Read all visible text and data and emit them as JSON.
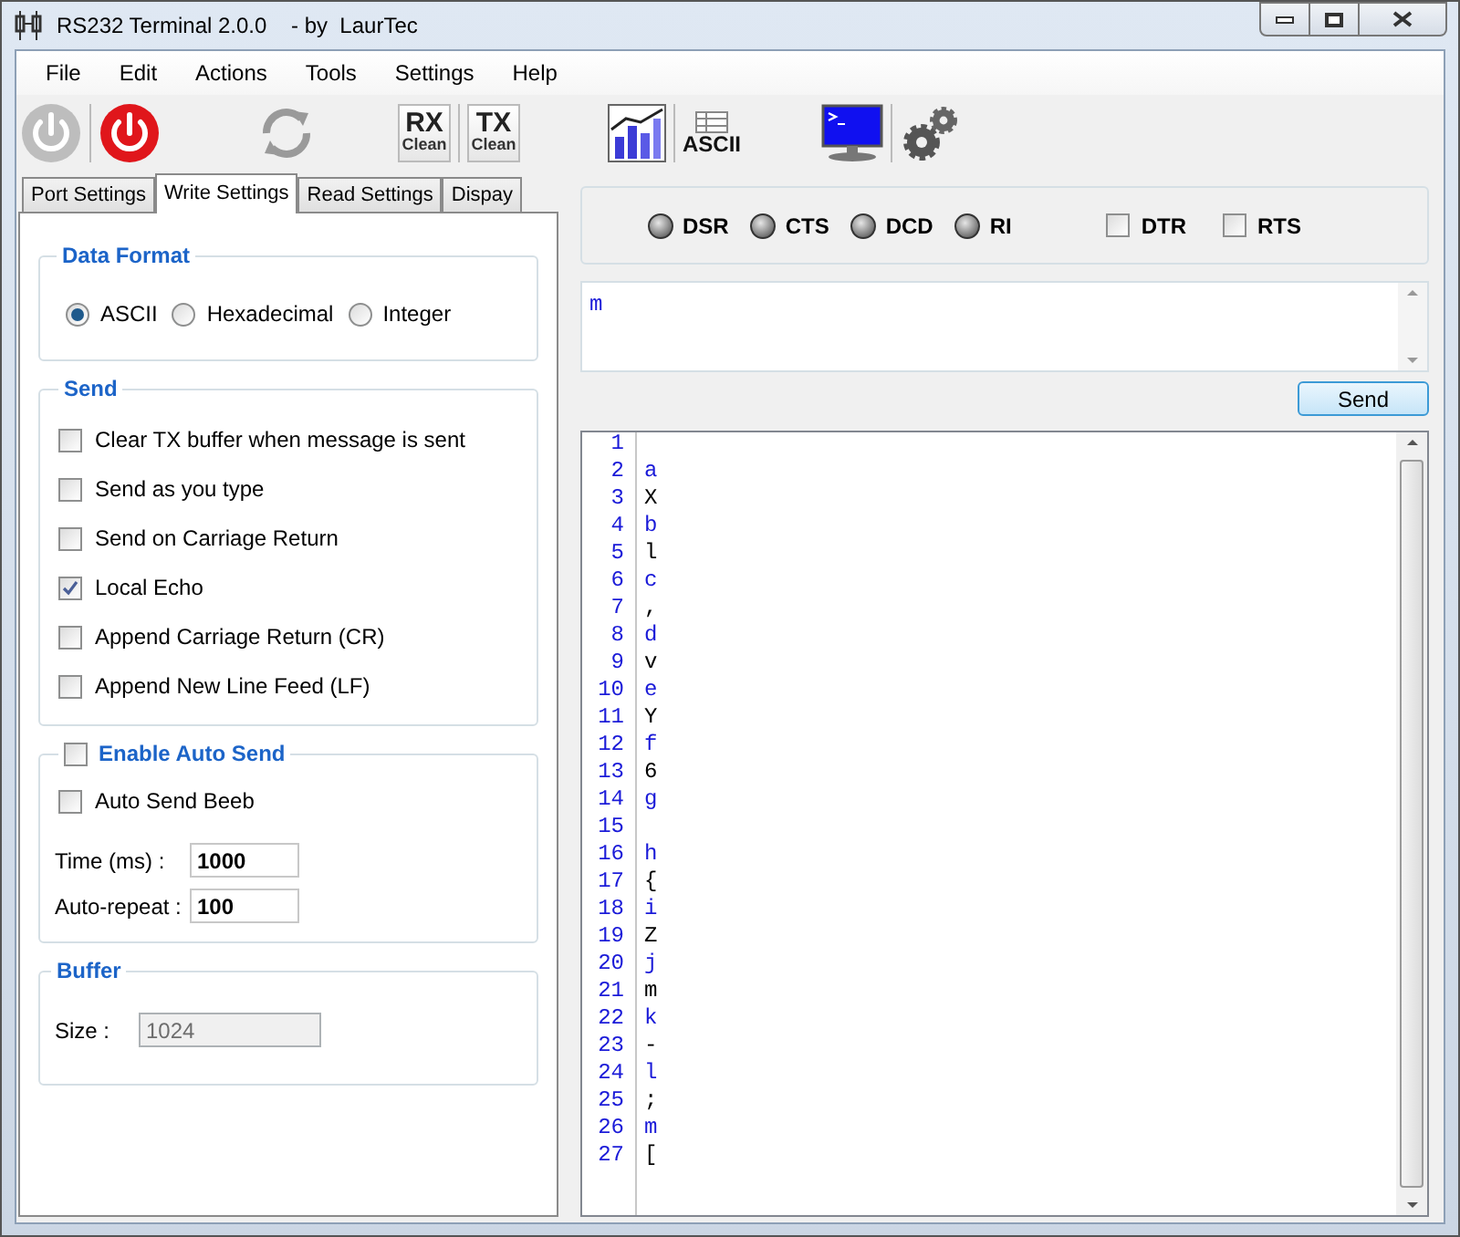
{
  "window": {
    "title": "RS232 Terminal 2.0.0    - by  LaurTec"
  },
  "menu": [
    {
      "label": "File"
    },
    {
      "label": "Edit"
    },
    {
      "label": "Actions"
    },
    {
      "label": "Tools"
    },
    {
      "label": "Settings"
    },
    {
      "label": "Help"
    }
  ],
  "toolbar": [
    {
      "kind": "power",
      "disabled": true
    },
    {
      "kind": "power",
      "disabled": false
    },
    {
      "kind": "refresh",
      "disabled": true
    },
    {
      "kind": "clean",
      "label": "RX",
      "caption": "Clean"
    },
    {
      "kind": "clean",
      "label": "TX",
      "caption": "Clean"
    },
    {
      "kind": "chart"
    },
    {
      "kind": "ascii",
      "label": "ASCII"
    },
    {
      "kind": "terminal"
    },
    {
      "kind": "gears"
    }
  ],
  "tabs": [
    {
      "label": "Port Settings",
      "selected": false
    },
    {
      "label": "Write Settings",
      "selected": true
    },
    {
      "label": "Read Settings",
      "selected": false
    },
    {
      "label": "Dispay",
      "selected": false
    }
  ],
  "data_format": {
    "title": "Data Format",
    "options": [
      {
        "label": "ASCII",
        "selected": true
      },
      {
        "label": "Hexadecimal",
        "selected": false
      },
      {
        "label": "Integer",
        "selected": false
      }
    ]
  },
  "send": {
    "title": "Send",
    "options": [
      {
        "label": "Clear TX buffer when message is sent",
        "checked": false
      },
      {
        "label": "Send as you type",
        "checked": false
      },
      {
        "label": "Send on Carriage Return",
        "checked": false
      },
      {
        "label": "Local Echo",
        "checked": true
      },
      {
        "label": "Append Carriage Return (CR)",
        "checked": false
      },
      {
        "label": "Append New Line Feed (LF)",
        "checked": false
      }
    ]
  },
  "auto_send": {
    "title": "Enable Auto Send",
    "checked": false,
    "options": [
      {
        "label": "Auto Send Beeb",
        "checked": false
      }
    ],
    "fields": [
      {
        "label": "Time (ms) :",
        "value": "1000"
      },
      {
        "label": "Auto-repeat :",
        "value": "100"
      }
    ]
  },
  "buffer": {
    "title": "Buffer",
    "field": {
      "label": "Size :",
      "value": "1024",
      "disabled": true
    }
  },
  "signals": [
    {
      "label": "DSR",
      "on": false
    },
    {
      "label": "CTS",
      "on": false
    },
    {
      "label": "DCD",
      "on": false
    },
    {
      "label": "RI",
      "on": false
    }
  ],
  "controls": [
    {
      "label": "DTR",
      "checked": false
    },
    {
      "label": "RTS",
      "checked": false
    }
  ],
  "tx_box": {
    "value": "m"
  },
  "send_button": {
    "label": "Send"
  },
  "terminal": {
    "lines": [
      {
        "number": "1"
      },
      {
        "number": "2",
        "text": "a",
        "kind": "tx"
      },
      {
        "number": "3",
        "text": "X",
        "kind": "rx"
      },
      {
        "number": "4",
        "text": "b",
        "kind": "tx"
      },
      {
        "number": "5",
        "text": "l",
        "kind": "rx"
      },
      {
        "number": "6",
        "text": "c",
        "kind": "tx"
      },
      {
        "number": "7",
        "text": ",",
        "kind": "rx"
      },
      {
        "number": "8",
        "text": "d",
        "kind": "tx"
      },
      {
        "number": "9",
        "text": "v",
        "kind": "rx"
      },
      {
        "number": "10",
        "text": "e",
        "kind": "tx"
      },
      {
        "number": "11",
        "text": "Y",
        "kind": "rx"
      },
      {
        "number": "12",
        "text": "f",
        "kind": "tx"
      },
      {
        "number": "13",
        "text": "6",
        "kind": "rx"
      },
      {
        "number": "14",
        "text": "g",
        "kind": "tx"
      },
      {
        "number": "15"
      },
      {
        "number": "16",
        "text": "h",
        "kind": "tx"
      },
      {
        "number": "17",
        "text": "{",
        "kind": "rx"
      },
      {
        "number": "18",
        "text": "i",
        "kind": "tx"
      },
      {
        "number": "19",
        "text": "Z",
        "kind": "rx"
      },
      {
        "number": "20",
        "text": "j",
        "kind": "tx"
      },
      {
        "number": "21",
        "text": "m",
        "kind": "rx"
      },
      {
        "number": "22",
        "text": "k",
        "kind": "tx"
      },
      {
        "number": "23",
        "text": "-",
        "kind": "rx"
      },
      {
        "number": "24",
        "text": "l",
        "kind": "tx"
      },
      {
        "number": "25",
        "text": ";",
        "kind": "rx"
      },
      {
        "number": "26",
        "text": "m",
        "kind": "tx"
      },
      {
        "number": "27",
        "text": "[",
        "kind": "rx"
      }
    ]
  }
}
